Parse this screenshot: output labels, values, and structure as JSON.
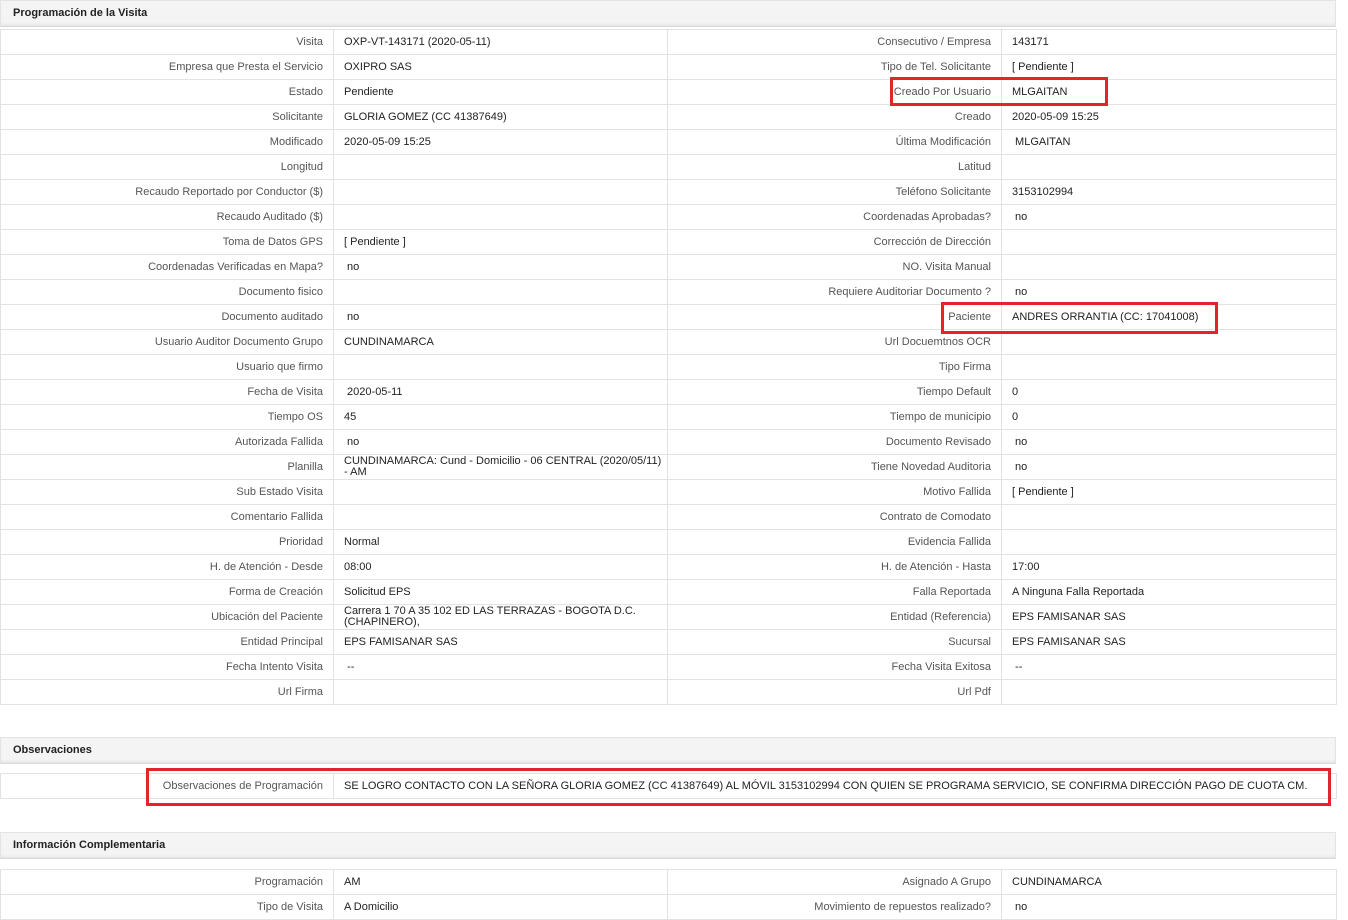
{
  "sections": {
    "programacion": "Programación de la Visita",
    "observaciones": "Observaciones",
    "info": "Información Complementaria"
  },
  "rows": [
    {
      "l1": "Visita",
      "v1": "OXP-VT-143171 (2020-05-11)",
      "l2": "Consecutivo / Empresa",
      "v2": "143171"
    },
    {
      "l1": "Empresa que Presta el Servicio",
      "v1": "OXIPRO SAS",
      "l2": "Tipo de Tel. Solicitante",
      "v2": "[ Pendiente ]"
    },
    {
      "l1": "Estado",
      "v1": "Pendiente",
      "l2": "Creado Por Usuario",
      "v2": "MLGAITAN"
    },
    {
      "l1": "Solicitante",
      "v1": "GLORIA GOMEZ (CC 41387649)",
      "l2": "Creado",
      "v2": "2020-05-09 15:25"
    },
    {
      "l1": "Modificado",
      "v1": "2020-05-09 15:25",
      "l2": "Última Modificación",
      "v2": " MLGAITAN"
    },
    {
      "l1": "Longitud",
      "v1": "",
      "l2": "Latitud",
      "v2": ""
    },
    {
      "l1": "Recaudo Reportado por Conductor ($)",
      "v1": "",
      "l2": "Teléfono Solicitante",
      "v2": "3153102994"
    },
    {
      "l1": "Recaudo Auditado ($)",
      "v1": "",
      "l2": "Coordenadas Aprobadas?",
      "v2": " no"
    },
    {
      "l1": "Toma de Datos GPS",
      "v1": "[ Pendiente ]",
      "l2": "Corrección de Dirección",
      "v2": ""
    },
    {
      "l1": "Coordenadas Verificadas en Mapa?",
      "v1": " no",
      "l2": "NO. Visita Manual",
      "v2": ""
    },
    {
      "l1": "Documento fisico",
      "v1": "",
      "l2": "Requiere Auditoriar Documento ?",
      "v2": " no"
    },
    {
      "l1": "Documento auditado",
      "v1": " no",
      "l2": "Paciente",
      "v2": "ANDRES ORRANTIA (CC: 17041008)"
    },
    {
      "l1": "Usuario Auditor Documento Grupo",
      "v1": "CUNDINAMARCA",
      "l2": "Url Docuemtnos OCR",
      "v2": ""
    },
    {
      "l1": "Usuario que firmo",
      "v1": "",
      "l2": "Tipo Firma",
      "v2": ""
    },
    {
      "l1": "Fecha de Visita",
      "v1": " 2020-05-11",
      "l2": "Tiempo Default",
      "v2": "0"
    },
    {
      "l1": "Tiempo OS",
      "v1": "45",
      "l2": "Tiempo de municipio",
      "v2": "0"
    },
    {
      "l1": "Autorizada Fallida",
      "v1": " no",
      "l2": "Documento Revisado",
      "v2": " no"
    },
    {
      "l1": "Planilla",
      "v1": "CUNDINAMARCA: Cund - Domicilio - 06 CENTRAL (2020/05/11) - AM",
      "l2": "Tiene Novedad Auditoria",
      "v2": " no"
    },
    {
      "l1": "Sub Estado Visita",
      "v1": "",
      "l2": "Motivo Fallida",
      "v2": "[ Pendiente ]"
    },
    {
      "l1": "Comentario Fallida",
      "v1": "",
      "l2": "Contrato de Comodato",
      "v2": ""
    },
    {
      "l1": "Prioridad",
      "v1": "Normal",
      "l2": "Evidencia Fallida",
      "v2": ""
    },
    {
      "l1": "H. de Atención - Desde",
      "v1": "08:00",
      "l2": "H. de Atención - Hasta",
      "v2": "17:00"
    },
    {
      "l1": "Forma de Creación",
      "v1": "Solicitud EPS",
      "l2": "Falla Reportada",
      "v2": "A Ninguna Falla Reportada"
    },
    {
      "l1": "Ubicación del Paciente",
      "v1": "Carrera 1 70 A 35 102 ED LAS TERRAZAS - BOGOTA D.C. (CHAPINERO),",
      "l2": "Entidad (Referencia)",
      "v2": "EPS FAMISANAR SAS"
    },
    {
      "l1": "Entidad Principal",
      "v1": "EPS FAMISANAR SAS",
      "l2": "Sucursal",
      "v2": "EPS FAMISANAR SAS"
    },
    {
      "l1": "Fecha Intento Visita",
      "v1": " --",
      "l2": "Fecha Visita Exitosa",
      "v2": " --"
    },
    {
      "l1": "Url Firma",
      "v1": "",
      "l2": "Url Pdf",
      "v2": ""
    }
  ],
  "observaciones": {
    "label": "Observaciones de Programación",
    "value": "SE LOGRO CONTACTO CON LA SEÑORA GLORIA GOMEZ (CC 41387649) AL MÓVIL 3153102994 CON QUIEN SE PROGRAMA SERVICIO, SE CONFIRMA DIRECCIÓN PAGO DE CUOTA CM."
  },
  "info_rows": [
    {
      "l1": "Programación",
      "v1": "AM",
      "l2": "Asignado A Grupo",
      "v2": "CUNDINAMARCA"
    },
    {
      "l1": "Tipo de Visita",
      "v1": "A Domicilio",
      "l2": "Movimiento de repuestos realizado?",
      "v2": " no"
    }
  ],
  "colors": {
    "highlight": "#e3242b",
    "header_bg": "#f4f4f4",
    "border": "#e2e2e2"
  }
}
